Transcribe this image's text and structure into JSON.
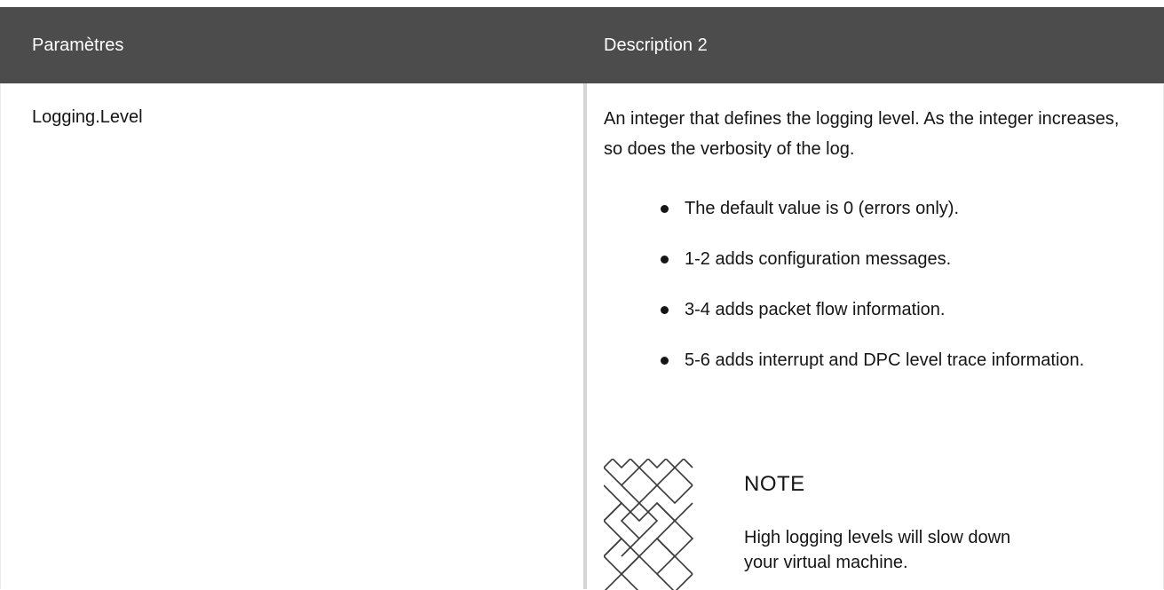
{
  "table": {
    "headers": {
      "parameter": "Paramètres",
      "description": "Description 2"
    },
    "row": {
      "parameter": "Logging.Level",
      "description": "An integer that defines the logging level. As the integer increases, so does the verbosity of the log.",
      "bullets": [
        "The default value is 0 (errors only).",
        "1-2 adds configuration messages.",
        "3-4 adds packet flow information.",
        "5-6 adds interrupt and DPC level trace information."
      ],
      "note": {
        "icon": "note-pattern-icon",
        "title": "NOTE",
        "text": "High logging levels will slow down your virtual machine."
      }
    }
  },
  "colors": {
    "header_bg": "#4c4c4c",
    "header_text": "#ffffff",
    "body_text": "#151515",
    "divider": "#d6d6d6"
  }
}
